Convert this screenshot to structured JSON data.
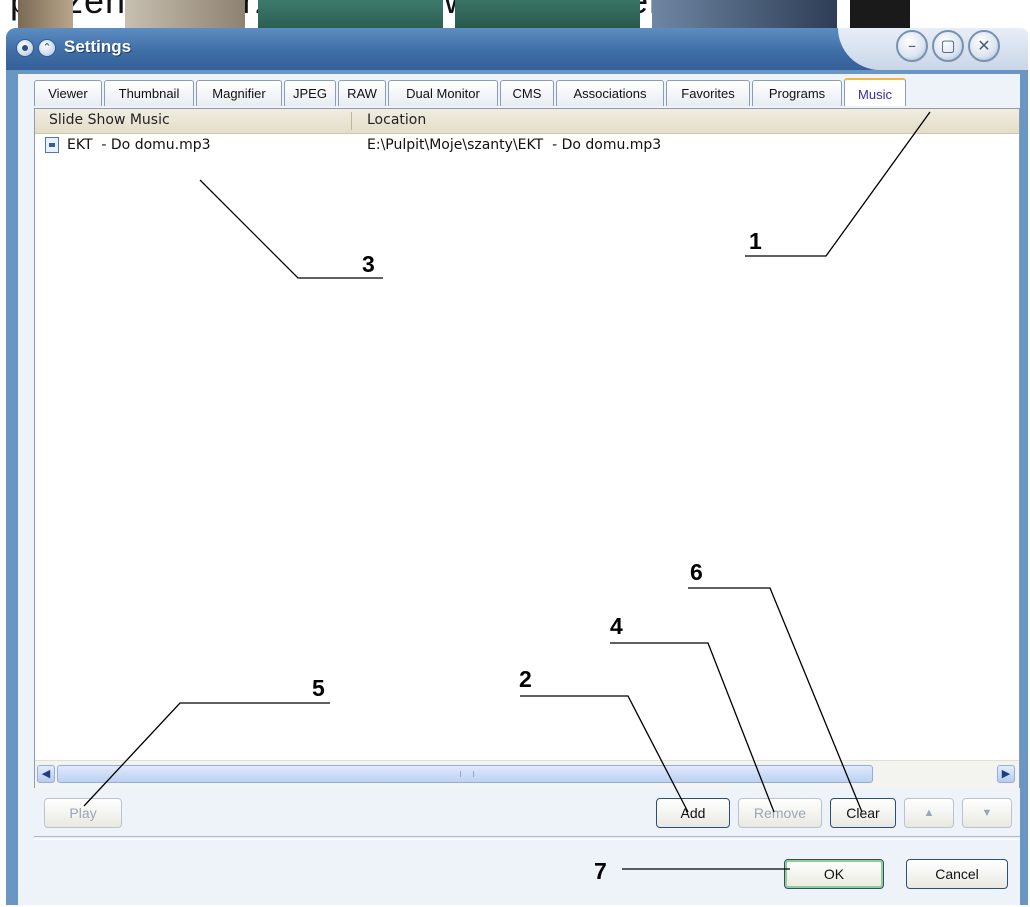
{
  "background": {
    "text": "prezentacji.     Przyciskiem     (w)     wywołujemy     o"
  },
  "window": {
    "title": "Settings",
    "buttons": {
      "minimize": "–",
      "maximize": "▢",
      "close": "✕"
    }
  },
  "tabs": [
    {
      "label": "Viewer"
    },
    {
      "label": "Thumbnail"
    },
    {
      "label": "Magnifier"
    },
    {
      "label": "JPEG"
    },
    {
      "label": "RAW"
    },
    {
      "label": "Dual Monitor"
    },
    {
      "label": "CMS"
    },
    {
      "label": "Associations"
    },
    {
      "label": "Favorites"
    },
    {
      "label": "Programs"
    },
    {
      "label": "Music",
      "active": true
    }
  ],
  "list": {
    "columns": [
      "Slide Show Music",
      "Location"
    ],
    "rows": [
      {
        "name": "EKT  - Do domu.mp3",
        "location": "E:\\Pulpit\\Moje\\szanty\\EKT  - Do domu.mp3"
      }
    ]
  },
  "buttons": {
    "play": "Play",
    "add": "Add",
    "remove": "Remove",
    "clear": "Clear",
    "up": "▲",
    "down": "▼",
    "ok": "OK",
    "cancel": "Cancel"
  },
  "annotations": [
    "1",
    "2",
    "3",
    "4",
    "5",
    "6",
    "7"
  ]
}
